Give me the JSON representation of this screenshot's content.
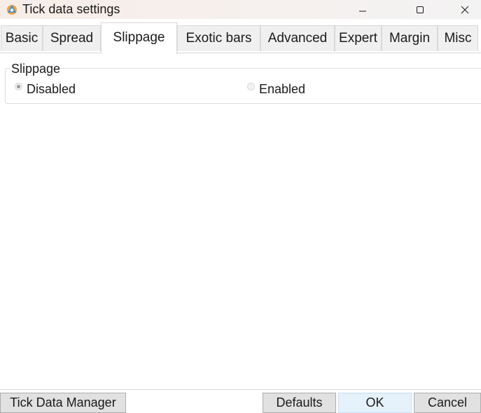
{
  "window": {
    "title": "Tick data settings",
    "app_icon": "app-logo-icon",
    "controls": [
      "minimize-icon",
      "maximize-icon",
      "close-icon"
    ]
  },
  "tabs": [
    {
      "label": "Basic",
      "active": false
    },
    {
      "label": "Spread",
      "active": false
    },
    {
      "label": "Slippage",
      "active": true
    },
    {
      "label": "Exotic bars",
      "active": false
    },
    {
      "label": "Advanced",
      "active": false
    },
    {
      "label": "Expert",
      "active": false
    },
    {
      "label": "Margin",
      "active": false
    },
    {
      "label": "Misc",
      "active": false
    }
  ],
  "slippage_group": {
    "legend": "Slippage",
    "options": [
      {
        "label": "Disabled",
        "checked": true
      },
      {
        "label": "Enabled",
        "checked": false
      }
    ]
  },
  "buttons": {
    "tick_data_manager": "Tick Data Manager",
    "defaults": "Defaults",
    "ok": "OK",
    "cancel": "Cancel"
  },
  "colors": {
    "titlebar": "#f6efeb",
    "tab_inactive": "#f0f0f0",
    "button_face": "#e1e1e1",
    "ok_button": "#e5f1fb"
  }
}
